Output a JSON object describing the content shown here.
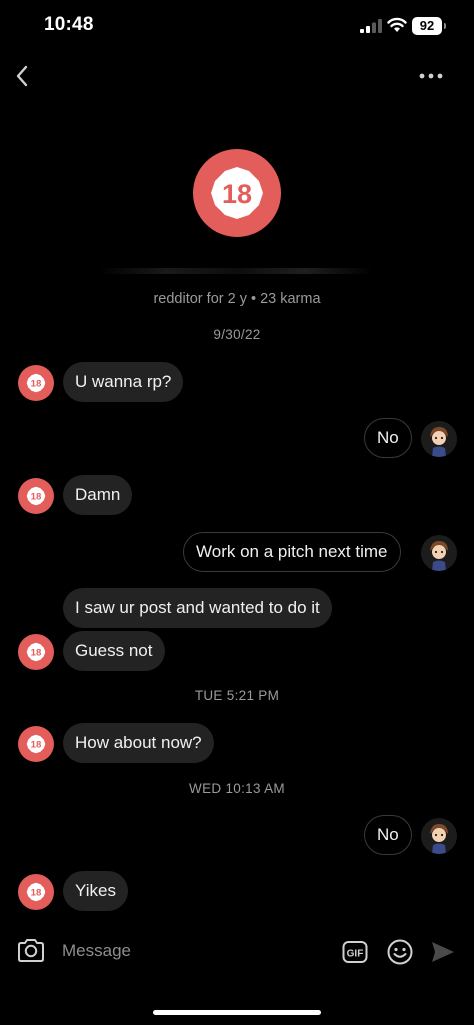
{
  "status_bar": {
    "time": "10:48",
    "battery": "92"
  },
  "header": {
    "avatar_badge": "18",
    "profile_subtitle": "redditor for 2 y • 23 karma"
  },
  "thread": {
    "date_divider": "9/30/22",
    "messages": [
      {
        "from": "them",
        "text": "U wanna rp?"
      },
      {
        "from": "me",
        "text": "No"
      },
      {
        "from": "them",
        "text": "Damn"
      },
      {
        "from": "me",
        "text": "Work on a pitch next time"
      },
      {
        "from": "them",
        "text": "I saw ur post and wanted to do it"
      },
      {
        "from": "them",
        "text": "Guess not"
      },
      {
        "from": "them",
        "text": "How about now?"
      },
      {
        "from": "me",
        "text": "No"
      },
      {
        "from": "them",
        "text": "Yikes"
      }
    ],
    "time_dividers": [
      "TUE 5:21 PM",
      "WED 10:13 AM"
    ]
  },
  "composer": {
    "placeholder": "Message",
    "gif_label": "GIF"
  },
  "icons": {
    "back": "chevron-left-icon",
    "more": "more-horizontal-icon",
    "camera": "camera-icon",
    "gif": "gif-icon",
    "emoji": "emoji-icon",
    "send": "send-icon"
  },
  "colors": {
    "avatar_red": "#e35d5b",
    "incoming_bubble": "#232323",
    "outgoing_border": "#3a3a3a",
    "muted_text": "#9a9a9a"
  }
}
